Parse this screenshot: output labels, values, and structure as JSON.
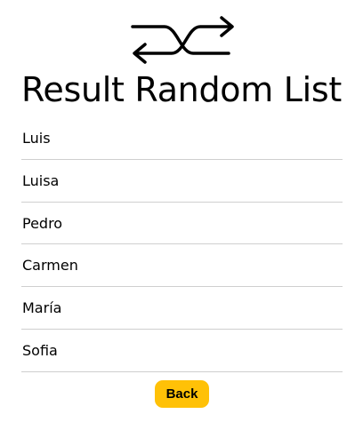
{
  "header": {
    "icon": "shuffle-icon",
    "title": "Result Random List"
  },
  "list": {
    "items": [
      "Luis",
      "Luisa",
      "Pedro",
      "Carmen",
      "María",
      "Sofia"
    ]
  },
  "actions": {
    "back_label": "Back",
    "back_color": "#ffc107"
  }
}
